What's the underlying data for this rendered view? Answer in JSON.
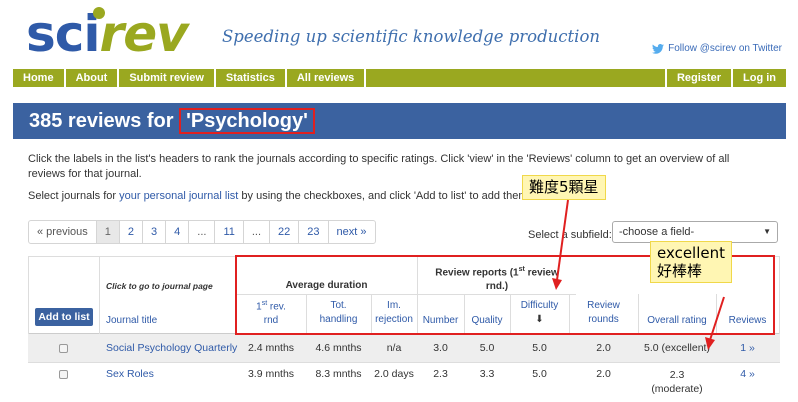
{
  "header": {
    "logo_sci": "sci",
    "logo_rev": "rev",
    "tagline": "Speeding up scientific knowledge production",
    "twitter_label": "Follow @scirev on Twitter"
  },
  "nav": {
    "items": [
      "Home",
      "About",
      "Submit review",
      "Statistics",
      "All reviews"
    ],
    "right_items": [
      "Register",
      "Log in"
    ]
  },
  "title": {
    "prefix": "385 reviews for ",
    "subject": "'Psychology'"
  },
  "intro": {
    "line1": "Click the labels in the list's headers to rank the journals according to specific ratings. Click 'view' in the 'Reviews' column to get an overview of all reviews for that journal.",
    "line2_pre": "Select journals for ",
    "line2_link": "your personal journal list",
    "line2_post": " by using the checkboxes, and click 'Add to list' to add them."
  },
  "pagination": {
    "previous": "« previous",
    "pages": [
      "1",
      "2",
      "3",
      "4",
      "...",
      "11",
      "...",
      "22",
      "23"
    ],
    "next": "next »"
  },
  "subfield": {
    "label": "Select a subfield:",
    "selected": "-choose a field-"
  },
  "table": {
    "click_hint": "Click to go to journal page",
    "add_button": "Add to list",
    "journal_title_header": "Journal title",
    "group_avg_duration": "Average duration",
    "group_review_reports_1": "Review reports (1",
    "group_review_reports_sup": "st",
    "group_review_reports_2": " review",
    "group_review_reports_3": "rnd.)",
    "headers": {
      "first_rev_sup": "st",
      "first_rev_1": "1",
      "first_rev_2": " rev.",
      "first_rev_3": "rnd",
      "tot_1": "Tot.",
      "tot_2": "handling",
      "im_1": "Im.",
      "im_2": "rejection",
      "number": "Number",
      "quality": "Quality",
      "difficulty": "Difficulty",
      "difficulty_arrow": "⬇",
      "rounds_1": "Review",
      "rounds_2": "rounds",
      "overall": "Overall rating",
      "reviews": "Reviews"
    },
    "rows": [
      {
        "title": "Social Psychology Quarterly",
        "first_rev": "2.4 mnths",
        "tot": "4.6 mnths",
        "im": "n/a",
        "number": "3.0",
        "quality": "5.0",
        "difficulty": "5.0",
        "rounds": "2.0",
        "overall": "5.0 (excellent)",
        "reviews": "1 »"
      },
      {
        "title": "Sex Roles",
        "first_rev": "3.9 mnths",
        "tot": "8.3 mnths",
        "im": "2.0 days",
        "number": "2.3",
        "quality": "3.3",
        "difficulty": "5.0",
        "rounds": "2.0",
        "overall": "2.3",
        "overall_sub": "(moderate)",
        "reviews": "4 »"
      }
    ]
  },
  "annotations": {
    "note_difficulty": "難度5顆星",
    "note_excellent_1": "excellent",
    "note_excellent_2": "好棒棒"
  },
  "colors": {
    "brand_blue": "#3b62a0",
    "brand_green": "#9aa820",
    "annotation_red": "#e02020",
    "note_yellow": "#fff6b3"
  }
}
